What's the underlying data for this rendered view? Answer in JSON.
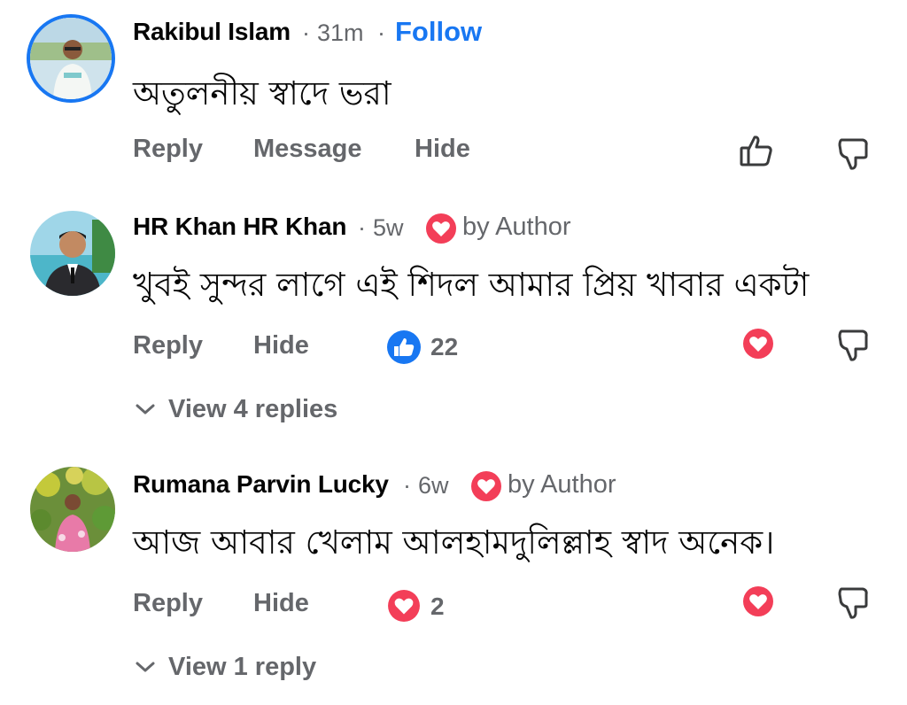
{
  "colors": {
    "text": "#050505",
    "secondary": "#65676b",
    "link_blue": "#1877f2",
    "love_red": "#f33e58",
    "like_blue": "#1877f2"
  },
  "comments": [
    {
      "author": "Rakibul Islam",
      "time": "31m",
      "separator": "·",
      "follow_label": "Follow",
      "text": "অতুলনীয় স্বাদে ভরা",
      "actions": [
        "Reply",
        "Message",
        "Hide"
      ],
      "icons": [
        "thumbs-up-outline-icon",
        "thumbs-down-outline-icon"
      ]
    },
    {
      "author": "HR Khan HR Khan",
      "time": "5w",
      "separator": "·",
      "badge_label": "by Author",
      "text": "খুবই সুন্দর লাগে এই শিদল আমার প্রিয় খাবার একটা",
      "actions": [
        "Reply",
        "Hide"
      ],
      "reaction_count": "22",
      "reaction_icon": "like-blue-icon",
      "replies_label": "View 4 replies"
    },
    {
      "author": "Rumana Parvin Lucky",
      "time": "6w",
      "separator": "·",
      "badge_label": "by Author",
      "text": "আজ আবার খেলাম আলহামদুলিল্লাহ স্বাদ অনেক।",
      "actions": [
        "Reply",
        "Hide"
      ],
      "reaction_count": "2",
      "reaction_icon": "love-heart-icon",
      "replies_label": "View 1 reply"
    }
  ]
}
